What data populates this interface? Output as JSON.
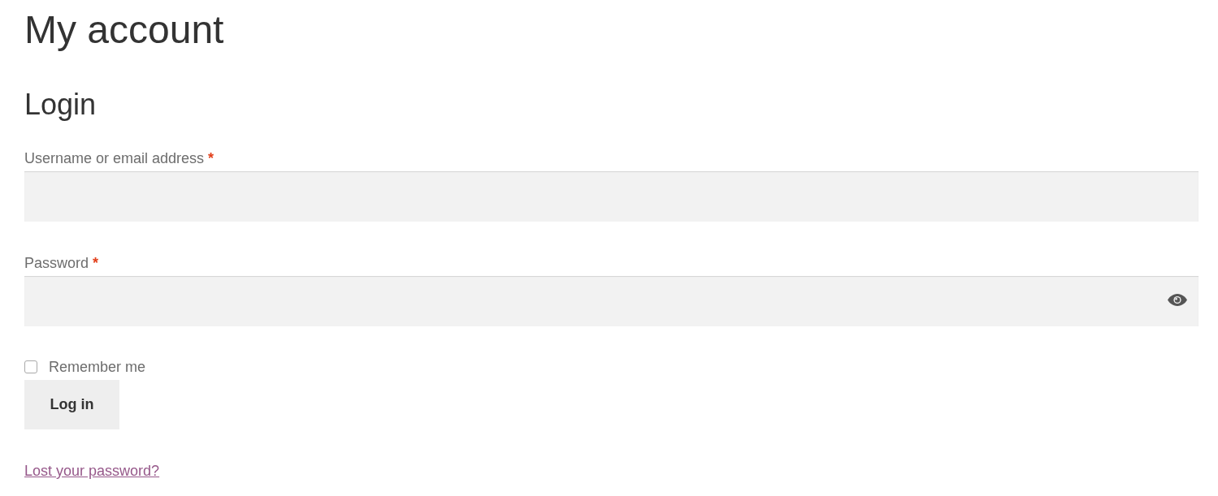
{
  "page": {
    "title": "My account"
  },
  "login": {
    "heading": "Login",
    "fields": [
      {
        "kind": "text",
        "label": "Username or email address",
        "required_mark": "*"
      },
      {
        "kind": "password",
        "label": "Password",
        "required_mark": "*"
      }
    ],
    "remember": {
      "label": "Remember me",
      "checked": false
    },
    "submit": {
      "label": "Log in"
    },
    "lost_password_link": "Lost your password?"
  }
}
